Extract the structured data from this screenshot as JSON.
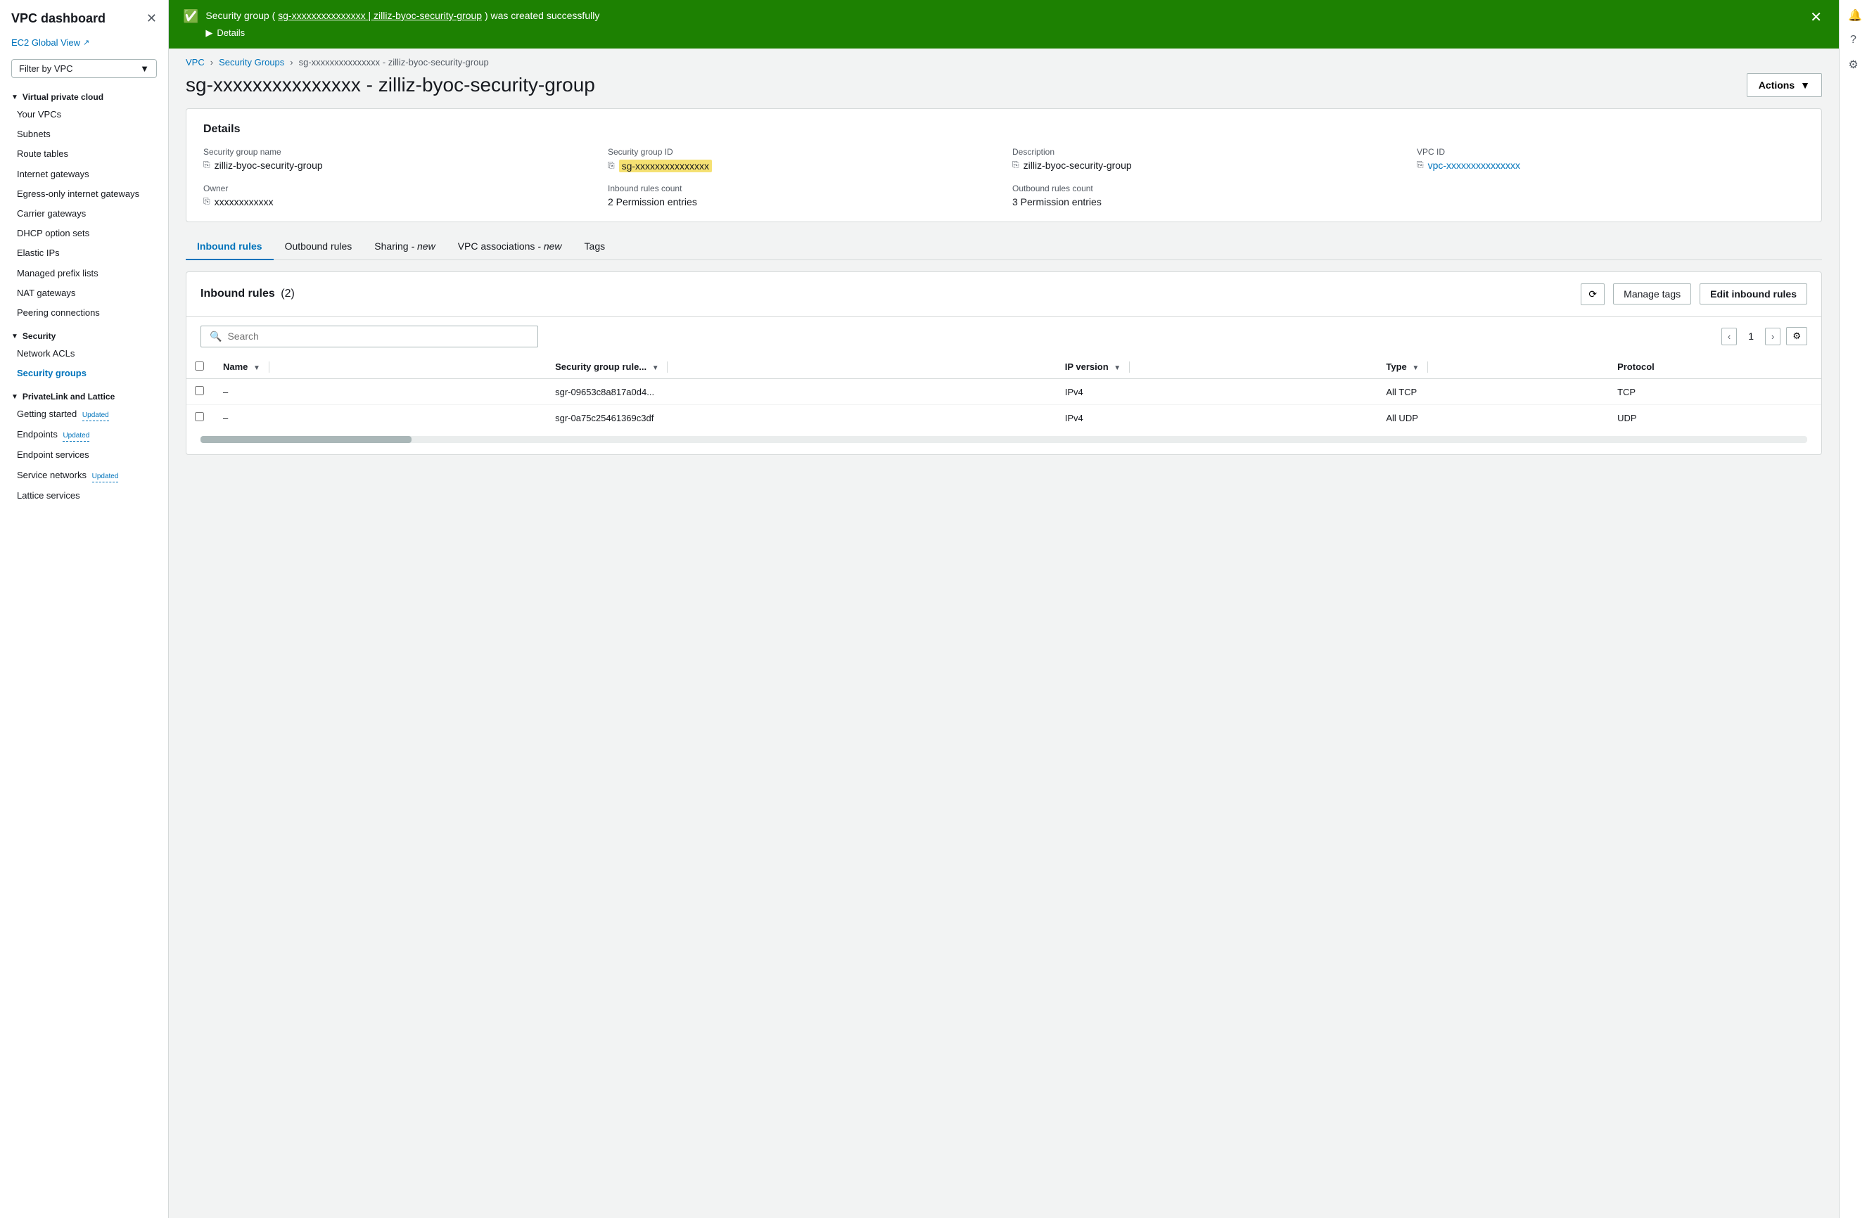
{
  "sidebar": {
    "title": "VPC dashboard",
    "ec2_global": "EC2 Global View",
    "filter_label": "Filter by VPC",
    "sections": [
      {
        "title": "Virtual private cloud",
        "items": [
          {
            "label": "Your VPCs",
            "active": false
          },
          {
            "label": "Subnets",
            "active": false
          },
          {
            "label": "Route tables",
            "active": false
          },
          {
            "label": "Internet gateways",
            "active": false
          },
          {
            "label": "Egress-only internet gateways",
            "active": false
          },
          {
            "label": "Carrier gateways",
            "active": false
          },
          {
            "label": "DHCP option sets",
            "active": false
          },
          {
            "label": "Elastic IPs",
            "active": false
          },
          {
            "label": "Managed prefix lists",
            "active": false
          },
          {
            "label": "NAT gateways",
            "active": false
          },
          {
            "label": "Peering connections",
            "active": false
          }
        ]
      },
      {
        "title": "Security",
        "items": [
          {
            "label": "Network ACLs",
            "active": false
          },
          {
            "label": "Security groups",
            "active": true
          }
        ]
      },
      {
        "title": "PrivateLink and Lattice",
        "items": [
          {
            "label": "Getting started",
            "active": false,
            "badge": "Updated"
          },
          {
            "label": "Endpoints",
            "active": false,
            "badge": "Updated"
          },
          {
            "label": "Endpoint services",
            "active": false
          },
          {
            "label": "Service networks",
            "active": false,
            "badge": "Updated"
          },
          {
            "label": "Lattice services",
            "active": false
          }
        ]
      }
    ]
  },
  "banner": {
    "text_prefix": "Security group (",
    "link_text": "sg-xxxxxxxxxxxxxxx | zilliz-byoc-security-group",
    "text_suffix": ") was created successfully",
    "details_label": "Details"
  },
  "breadcrumb": {
    "vpc": "VPC",
    "security_groups": "Security Groups",
    "current": "sg-xxxxxxxxxxxxxxx - zilliz-byoc-security-group"
  },
  "page": {
    "title": "sg-xxxxxxxxxxxxxxx - zilliz-byoc-security-group",
    "actions_label": "Actions"
  },
  "details": {
    "section_title": "Details",
    "fields": [
      {
        "label": "Security group name",
        "value": "zilliz-byoc-security-group",
        "has_copy": true,
        "highlight": false,
        "is_link": false
      },
      {
        "label": "Security group ID",
        "value": "sg-xxxxxxxxxxxxxxx",
        "has_copy": true,
        "highlight": true,
        "is_link": false
      },
      {
        "label": "Description",
        "value": "zilliz-byoc-security-group",
        "has_copy": true,
        "highlight": false,
        "is_link": false
      },
      {
        "label": "VPC ID",
        "value": "vpc-xxxxxxxxxxxxxxx",
        "has_copy": true,
        "highlight": false,
        "is_link": true
      },
      {
        "label": "Owner",
        "value": "xxxxxxxxxxxx",
        "has_copy": true,
        "highlight": false,
        "is_link": false
      },
      {
        "label": "Inbound rules count",
        "value": "2 Permission entries",
        "has_copy": false,
        "highlight": false,
        "is_link": false
      },
      {
        "label": "Outbound rules count",
        "value": "3 Permission entries",
        "has_copy": false,
        "highlight": false,
        "is_link": false
      }
    ]
  },
  "tabs": [
    {
      "label": "Inbound rules",
      "active": true,
      "italic_part": ""
    },
    {
      "label": "Outbound rules",
      "active": false,
      "italic_part": ""
    },
    {
      "label": "Sharing",
      "active": false,
      "italic_part": " - new"
    },
    {
      "label": "VPC associations",
      "active": false,
      "italic_part": " - new"
    },
    {
      "label": "Tags",
      "active": false,
      "italic_part": ""
    }
  ],
  "inbound_rules": {
    "title": "Inbound rules",
    "count": "(2)",
    "refresh_label": "⟳",
    "manage_tags_label": "Manage tags",
    "edit_rules_label": "Edit inbound rules",
    "search_placeholder": "Search",
    "page_number": "1",
    "columns": [
      "Name",
      "Security group rule...",
      "IP version",
      "Type",
      "Protocol"
    ],
    "rows": [
      {
        "name": "–",
        "rule_id": "sgr-09653c8a817a0d4...",
        "ip_version": "IPv4",
        "type": "All TCP",
        "protocol": "TCP"
      },
      {
        "name": "–",
        "rule_id": "sgr-0a75c25461369c3df",
        "ip_version": "IPv4",
        "type": "All UDP",
        "protocol": "UDP"
      }
    ]
  }
}
